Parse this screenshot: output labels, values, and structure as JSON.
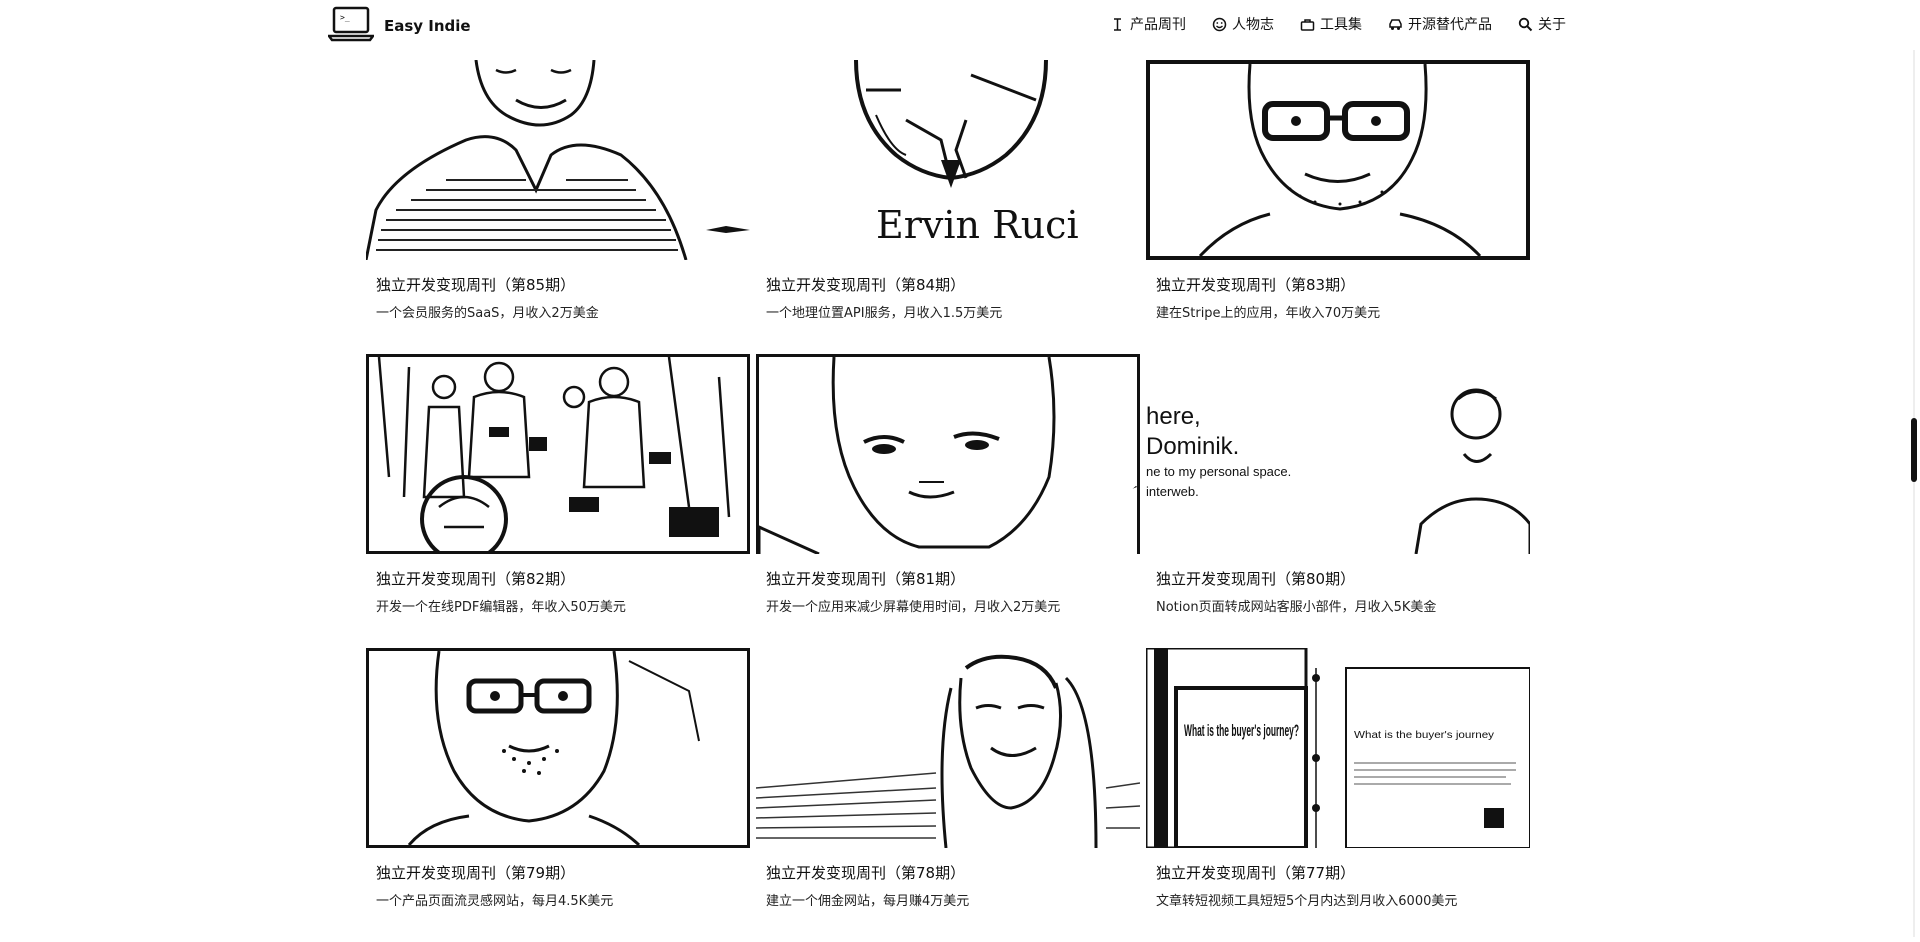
{
  "brand": {
    "name": "Easy Indie",
    "logo_icon": "laptop-terminal-icon"
  },
  "nav": [
    {
      "label": "产品周刊",
      "icon": "cursor-icon"
    },
    {
      "label": "人物志",
      "icon": "face-icon"
    },
    {
      "label": "工具集",
      "icon": "toolbox-icon"
    },
    {
      "label": "开源替代产品",
      "icon": "car-icon"
    },
    {
      "label": "关于",
      "icon": "search-icon"
    }
  ],
  "cards": [
    {
      "title": "独立开发变现周刊（第85期）",
      "desc": "一个会员服务的SaaS，月收入2万美金"
    },
    {
      "title": "独立开发变现周刊（第84期）",
      "desc": "一个地理位置API服务，月收入1.5万美元",
      "thumb_text": "Ervin Ruci"
    },
    {
      "title": "独立开发变现周刊（第83期）",
      "desc": "建在Stripe上的应用，年收入70万美元"
    },
    {
      "title": "独立开发变现周刊（第82期）",
      "desc": "开发一个在线PDF编辑器，年收入50万美元"
    },
    {
      "title": "独立开发变现周刊（第81期）",
      "desc": "开发一个应用来减少屏幕使用时间，月收入2万美元"
    },
    {
      "title": "独立开发变现周刊（第80期）",
      "desc": "Notion页面转成网站客服小部件，月收入5K美金",
      "thumb_text": [
        "here,",
        "Dominik.",
        "ne to my personal space.",
        "interweb."
      ]
    },
    {
      "title": "独立开发变现周刊（第79期）",
      "desc": "一个产品页面流灵感网站，每月4.5K美元"
    },
    {
      "title": "独立开发变现周刊（第78期）",
      "desc": "建立一个佣金网站，每月赚4万美元"
    },
    {
      "title": "独立开发变现周刊（第77期）",
      "desc": "文章转短视频工具短短5个月内达到月收入6000美元",
      "thumb_text": [
        "What is the buyer's journey?",
        "What is the buyer's journey"
      ]
    }
  ]
}
